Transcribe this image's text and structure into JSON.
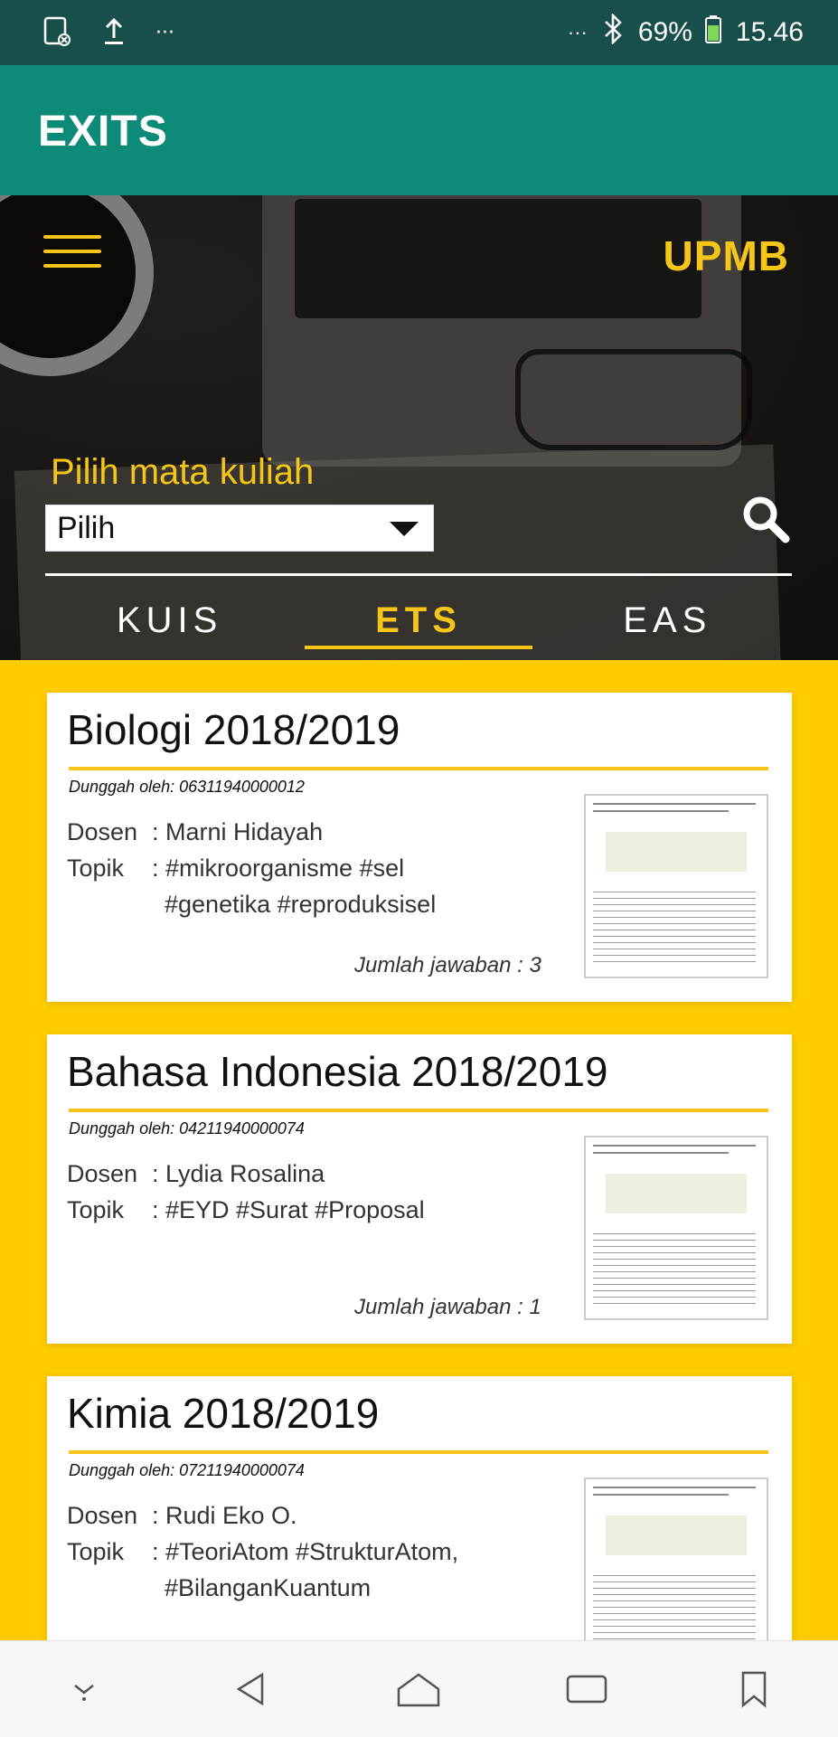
{
  "status_bar": {
    "left_icons": [
      "sd-card-icon",
      "upload-icon",
      "more-dots-icon"
    ],
    "dots": "···",
    "battery": "69%",
    "time": "15.46"
  },
  "app_bar": {
    "title": "EXITS"
  },
  "header": {
    "brand": "UPMB",
    "course_label": "Pilih mata kuliah",
    "select_value": "Pilih",
    "tabs": [
      {
        "label": "KUIS",
        "active": false
      },
      {
        "label": "ETS",
        "active": true
      },
      {
        "label": "EAS",
        "active": false
      }
    ]
  },
  "cards": [
    {
      "title": "Biologi 2018/2019",
      "uploader": "Dunggah oleh: 06311940000012",
      "dosen_key": "Dosen",
      "dosen_value": ": Marni Hidayah",
      "topik_key": "Topik",
      "topik_value": ": #mikroorganisme #sel",
      "topik_value2": "#genetika #reproduksisel",
      "count": "Jumlah jawaban : 3"
    },
    {
      "title": "Bahasa Indonesia 2018/2019",
      "uploader": "Dunggah oleh: 04211940000074",
      "dosen_key": "Dosen",
      "dosen_value": ": Lydia Rosalina",
      "topik_key": "Topik",
      "topik_value": ": #EYD #Surat #Proposal",
      "topik_value2": "",
      "count": "Jumlah jawaban : 1"
    },
    {
      "title": "Kimia 2018/2019",
      "uploader": "Dunggah oleh: 07211940000074",
      "dosen_key": "Dosen",
      "dosen_value": ": Rudi Eko O.",
      "topik_key": "Topik",
      "topik_value": ": #TeoriAtom #StrukturAtom,",
      "topik_value2": "#BilanganKuantum",
      "count": ""
    }
  ],
  "colors": {
    "status": "#184f4a",
    "appbar": "#0d8a78",
    "accent": "#f5c518",
    "background": "#ffcc00"
  },
  "nav_icons": [
    "download-icon",
    "back-icon",
    "home-icon",
    "recents-icon",
    "bookmark-icon"
  ]
}
